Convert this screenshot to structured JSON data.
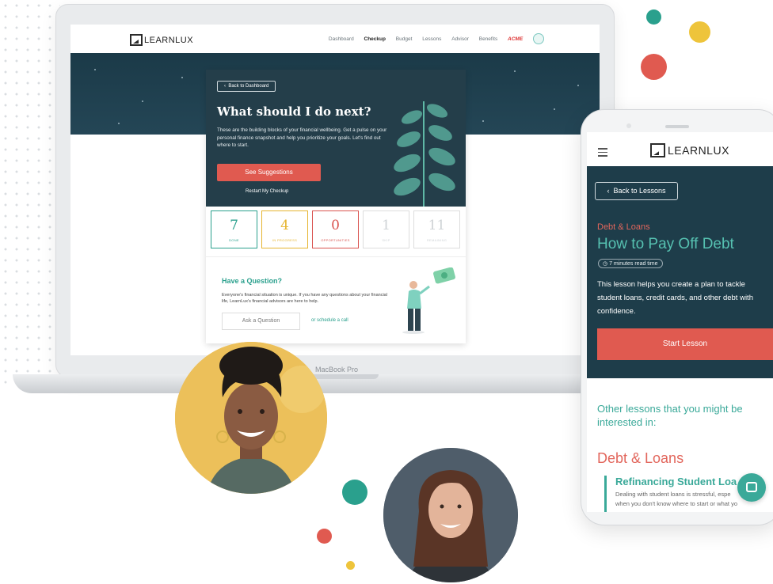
{
  "laptop": {
    "device_label": "MacBook Pro",
    "logo": "LEARNLUX",
    "nav": [
      "Dashboard",
      "Checkup",
      "Budget",
      "Lessons",
      "Advisor",
      "Benefits"
    ],
    "active_nav": "Checkup",
    "employer_logo": "ACME",
    "back_button": "Back to Dashboard",
    "title": "What should I do next?",
    "description": "These are the building blocks of your financial wellbeing. Get a pulse on your personal finance snapshot and help you prioritize your goals. Let's find out where to start.",
    "suggestions_button": "See Suggestions",
    "restart_link": "Restart My Checkup",
    "stats": [
      {
        "value": "7",
        "label": "DONE",
        "color": "#2aa08d"
      },
      {
        "value": "4",
        "label": "IN PROGRESS",
        "color": "#e6b530"
      },
      {
        "value": "0",
        "label": "OPPORTUNITIES",
        "color": "#d9534f"
      },
      {
        "value": "1",
        "label": "SKIP",
        "color": "#cfd3d6"
      },
      {
        "value": "11",
        "label": "REMAINING",
        "color": "#cfd3d6"
      }
    ],
    "question_title": "Have a Question?",
    "question_desc": "Everyone's financial situation is unique. If you have any questions about your financial life, LearnLux's financial advisors are here to help.",
    "ask_button": "Ask a Question",
    "schedule_link": "or schedule a call"
  },
  "phone": {
    "logo": "LEARNLUX",
    "back_button": "Back to Lessons",
    "category": "Debt & Loans",
    "title": "How to Pay Off Debt",
    "read_time": "7 minutes read time",
    "description": "This lesson helps you create a plan to tackle student loans, credit cards, and other debt with confidence.",
    "start_button": "Start Lesson",
    "other_heading": "Other lessons that you might be interested in:",
    "section_title": "Debt & Loans",
    "lesson_title": "Refinancing Student Loa",
    "lesson_desc_1": "Dealing with student loans is stressful, espe",
    "lesson_desc_2": "when you don't know where to start or what yo"
  },
  "colors": {
    "teal": "#2aa08d",
    "coral": "#e05a50",
    "yellow": "#eec43b",
    "navy": "#1e3d4a"
  }
}
